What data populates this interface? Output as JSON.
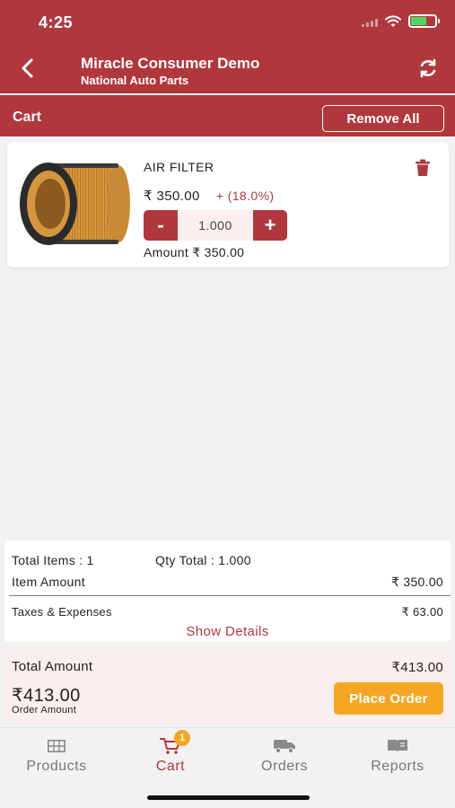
{
  "status_bar": {
    "time": "4:25"
  },
  "header": {
    "title": "Miracle Consumer Demo",
    "subtitle": "National Auto Parts",
    "cart_label": "Cart",
    "remove_all_label": "Remove All"
  },
  "cart_items": [
    {
      "name": "AIR FILTER",
      "price": "₹ 350.00",
      "tax": "+ (18.0%)",
      "quantity": "1.000",
      "minus_label": "-",
      "plus_label": "+",
      "amount": "Amount ₹ 350.00"
    }
  ],
  "summary": {
    "total_items": "Total Items : 1",
    "qty_total": "Qty Total : 1.000",
    "item_amount_label": "Item Amount",
    "item_amount_value": "₹ 350.00",
    "taxes_label": "Taxes & Expenses",
    "taxes_value": "₹ 63.00",
    "show_details": "Show Details"
  },
  "total": {
    "label": "Total Amount",
    "value": "₹413.00",
    "grand_value": "₹413.00",
    "grand_caption": "Order Amount",
    "place_order_label": "Place Order"
  },
  "tabs": [
    {
      "label": "Products",
      "icon": "grid-icon",
      "active": false
    },
    {
      "label": "Cart",
      "icon": "cart-icon",
      "active": true,
      "badge": "1"
    },
    {
      "label": "Orders",
      "icon": "truck-icon",
      "active": false
    },
    {
      "label": "Reports",
      "icon": "book-icon",
      "active": false
    }
  ],
  "colors": {
    "primary": "#b0383c",
    "accent": "#f5a623",
    "highlight_bg": "#fbeeee"
  }
}
